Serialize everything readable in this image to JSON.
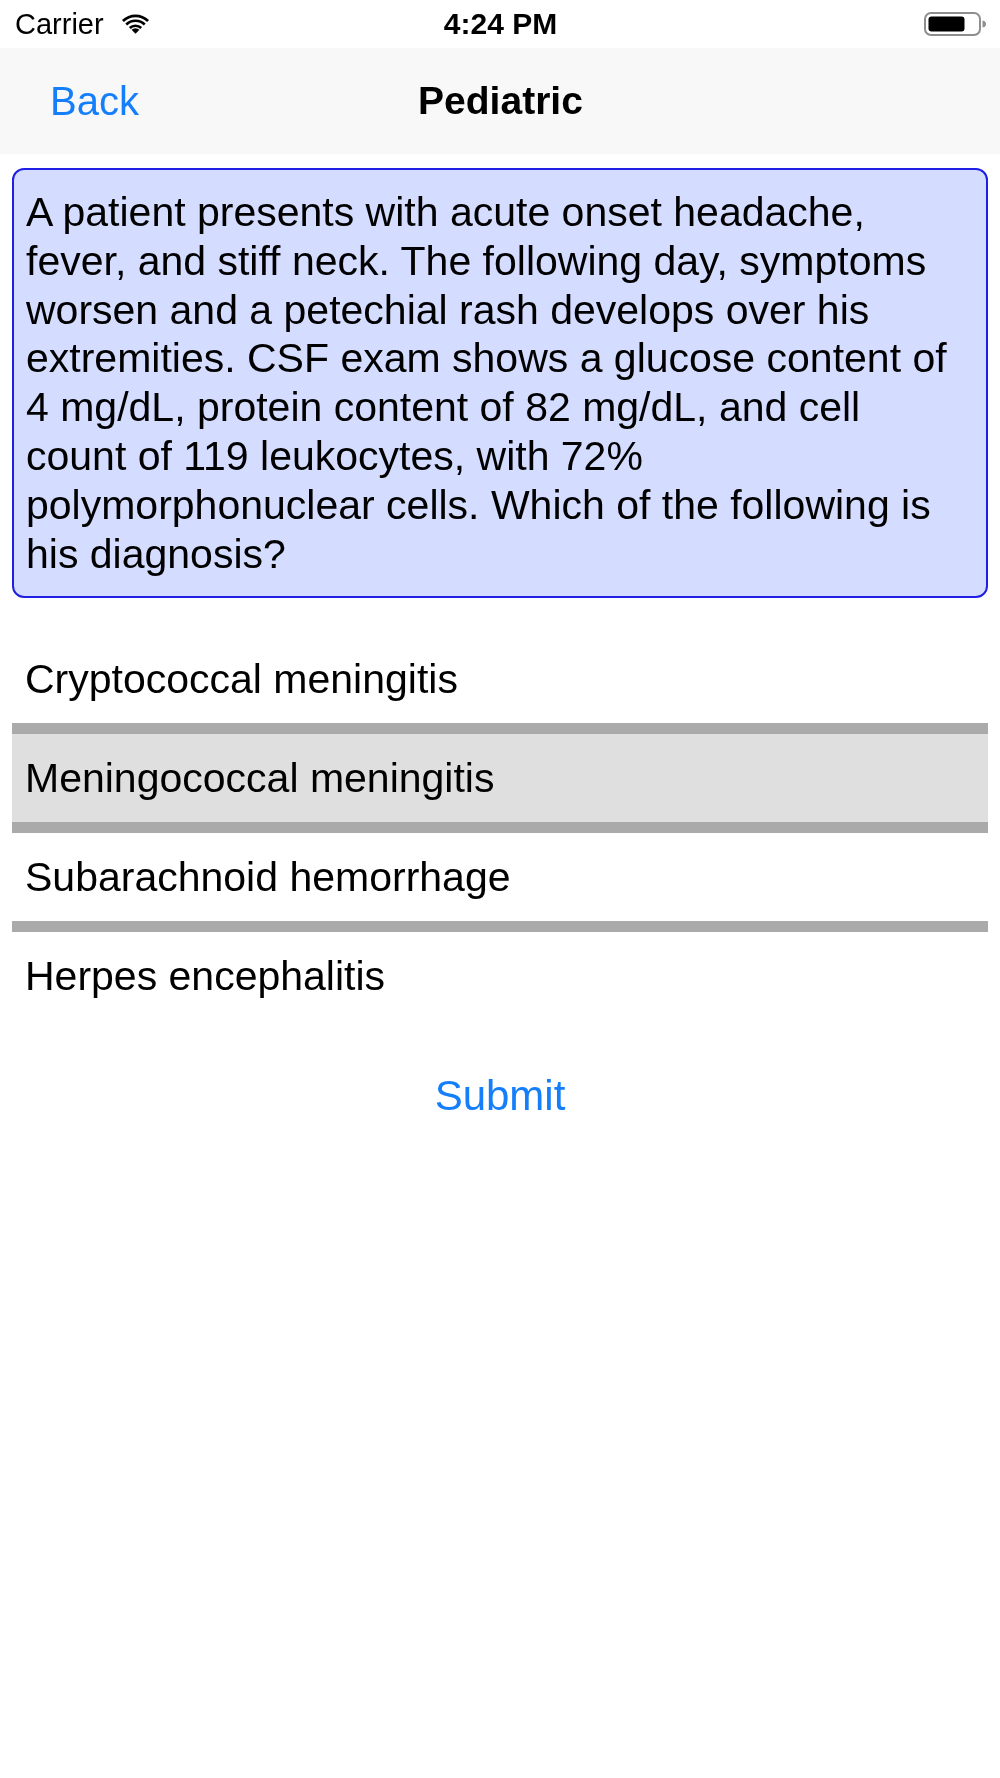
{
  "status_bar": {
    "carrier": "Carrier",
    "time": "4:24 PM"
  },
  "nav_bar": {
    "back": "Back",
    "title": "Pediatric"
  },
  "question": {
    "text": "A patient presents with acute onset headache, fever, and stiff neck. The following day, symptoms worsen and a petechial rash develops over his extremities. CSF exam shows a glucose content of 4 mg/dL, protein content of 82 mg/dL, and cell count of 119 leukocytes, with 72% polymorphonuclear cells. Which of the following is his diagnosis?"
  },
  "options": [
    {
      "label": "Cryptococcal meningitis",
      "selected": false
    },
    {
      "label": "Meningococcal meningitis",
      "selected": true
    },
    {
      "label": "Subarachnoid hemorrhage",
      "selected": false
    },
    {
      "label": "Herpes encephalitis",
      "selected": false
    }
  ],
  "submit": {
    "label": "Submit"
  }
}
